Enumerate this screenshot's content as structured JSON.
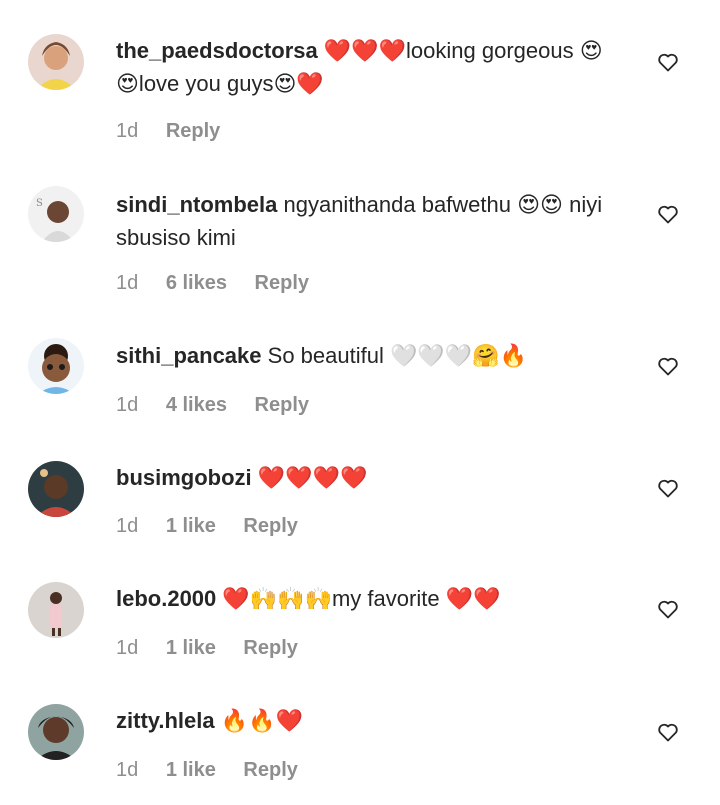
{
  "comments": [
    {
      "username": "the_paedsdoctorsa",
      "text": "❤️❤️❤️looking gorgeous 😍😍love you guys😍❤️",
      "time": "1d",
      "likes": "",
      "reply": "Reply"
    },
    {
      "username": "sindi_ntombela",
      "text": "ngyanithanda bafwethu 😍😍 niyi sbusiso kimi",
      "time": "1d",
      "likes": "6 likes",
      "reply": "Reply"
    },
    {
      "username": "sithi_pancake",
      "text": "So beautiful 🤍🤍🤍🤗🔥",
      "time": "1d",
      "likes": "4 likes",
      "reply": "Reply"
    },
    {
      "username": "busimgobozi",
      "text": "❤️❤️❤️❤️",
      "time": "1d",
      "likes": "1 like",
      "reply": "Reply"
    },
    {
      "username": "lebo.2000",
      "text": "❤️🙌🙌🙌my favorite ❤️❤️",
      "time": "1d",
      "likes": "1 like",
      "reply": "Reply"
    },
    {
      "username": "zitty.hlela",
      "text": "🔥🔥❤️",
      "time": "1d",
      "likes": "1 like",
      "reply": "Reply"
    }
  ],
  "icons": {
    "like": "heart-outline-icon"
  },
  "colors": {
    "text": "#262626",
    "meta": "#8e8e8e"
  }
}
